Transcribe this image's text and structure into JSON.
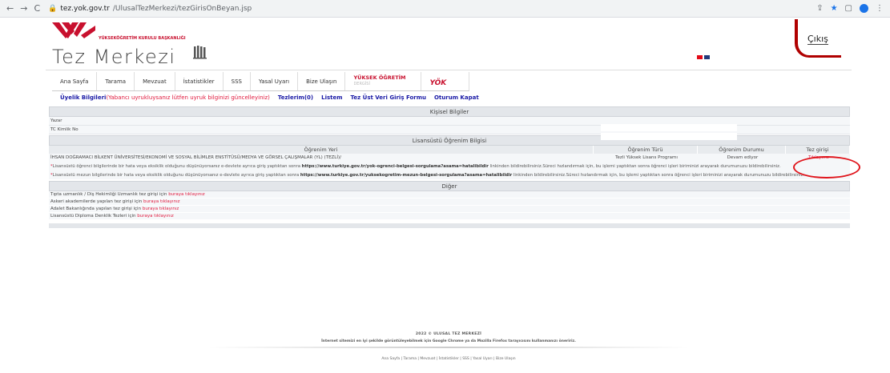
{
  "browser": {
    "url": "tez.yok.gov.tr/UlusalTezMerkezi/tezGirisOnBeyan.jsp",
    "domain": "tez.yok.gov.tr",
    "path": "/UlusalTezMerkezi/tezGirisOnBeyan.jsp"
  },
  "header": {
    "council_name": "YÜKSEKÖĞRETİM KURULU BAŞKANLIĞI",
    "site_title": "Tez Merkezi",
    "logout_label": "Çıkış"
  },
  "menu": {
    "items": [
      "Ana Sayfa",
      "Tarama",
      "Mevzuat",
      "İstatistikler",
      "SSS",
      "Yasal Uyarı",
      "Bize Ulaşın"
    ],
    "yuksek_ogretim": "YÜKSEK ÖĞRETİM",
    "yuksek_ogretim_sub": "DERGİSİ",
    "yok_logo": "YÖK"
  },
  "user_links": {
    "membership": "Üyelik Bilgileri",
    "membership_warning": "(Yabancı uyrukluysanız lütfen uyruk bilginizi güncelleyiniz)",
    "theses": "Tezlerim(0)",
    "list": "Listem",
    "meta_form": "Tez Üst Veri Giriş Formu",
    "logout": "Oturum Kapat"
  },
  "personal": {
    "title": "Kişisel Bilgiler",
    "author_label": "Yazar",
    "tc_label": "TC Kimlik No"
  },
  "graduate": {
    "title": "Lisansüstü Öğrenim Bilgisi",
    "columns": [
      "Öğrenim Yeri",
      "Öğrenim Türü",
      "Öğrenim Durumu",
      "Tez girişi"
    ],
    "row": {
      "place": "İHSAN DOĞRAMACI BİLKENT ÜNİVERSİTESİ/EKONOMİ VE SOSYAL BİLİMLER ENSTİTÜSÜ/MEDYA VE GÖRSEL ÇALIŞMALAR (YL) (TEZLİ)/",
      "type": "Tezli Yüksek Lisans Programı",
      "status": "Devam ediyor",
      "entry_link": "Tıklayınız"
    },
    "note1_a": "Lisansüstü öğrenci bilgilerinde bir hata veya eksiklik olduğunu düşünüyorsanız e-devlete ayrıca giriş yaptıktan sonra ",
    "note1_link": "https://www.turkiye.gov.tr/yok-ogrenci-belgesi-sorgulama?asama=hatalibildir",
    "note1_b": " linkinden bildirebilirsiniz.Süreci hızlandırmak için, bu işlemi yaptıktan sonra öğrenci işleri biriminizi arayarak durumunuzu bildirebilirsiniz.",
    "note2_a": "Lisansüstü mezun bilgilerinde bir hata veya eksiklik olduğunu düşünüyorsanız e-devlete ayrıca giriş yaptıktan sonra ",
    "note2_link": "https://www.turkiye.gov.tr/yuksekogretim-mezun-belgesi-sorgulama?asama=hatalibildir",
    "note2_b": " linkinden bildirebilirsiniz.Süreci hızlandırmak için, bu işlemi yaptıktan sonra öğrenci işleri biriminizi arayarak durumunuzu bildirebilirsiniz."
  },
  "other": {
    "title": "Diğer",
    "items": [
      {
        "text": "Tıpta uzmanlık / Diş Hekimliği Uzmanlık tez girişi için ",
        "link": "buraya tıklayınız"
      },
      {
        "text": "Askeri akademilerde yapılan tez girişi için ",
        "link": "buraya tıklayınız"
      },
      {
        "text": "Adalet Bakanlığında yapılan tez girişi için ",
        "link": "buraya tıklayınız"
      },
      {
        "text": "Lisansüstü Diploma Denklik Tezleri için ",
        "link": "buraya tıklayınız"
      }
    ]
  },
  "footer": {
    "copyright": "2022 © ULUSAL TEZ MERKEZİ",
    "browser_note": "İnternet sitemizi en iyi şekilde görüntüleyebilmek için Google Chrome ya da Mozilla Firefox tarayıcısını kullanmanızı öneririz.",
    "links": "Ana Sayfa | Tarama | Mevzuat | İstatistikler | SSS | Yasal Uyarı | Bize Ulaşın"
  },
  "colors": {
    "brand_red": "#c8102e",
    "link_blue": "#1a1aa6",
    "highlight": "#e0161d"
  }
}
